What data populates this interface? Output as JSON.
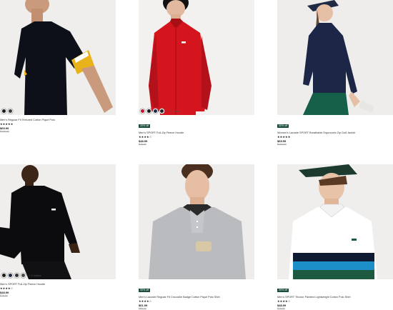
{
  "products": [
    {
      "badge": "",
      "name": "Men's Regular Fit Textured Cotton Piqué Polo",
      "stars": "★★★★★",
      "price": "$69.99",
      "old_price": "$100.00",
      "swatches": [
        "#1a1a1a",
        "#3b3b3b"
      ],
      "more": ""
    },
    {
      "badge": "30% off",
      "name": "Men's SPORT Full-Zip Fleece Hoodie",
      "stars": "★★★★☆",
      "price": "$48.99",
      "old_price": "$70.00",
      "swatches": [
        "#c8102e",
        "#1a1a1a",
        "#1f2a44",
        "#222222"
      ],
      "more": "+ 6 colors"
    },
    {
      "badge": "30% off",
      "name": "Women's Lacoste SPORT Breathable Ergonomic Zip Golf Jacket",
      "stars": "★★★★★",
      "price": "$69.99",
      "old_price": "$100.00",
      "swatches": [],
      "more": ""
    },
    {
      "badge": "",
      "name": "Men's SPORT Full-Zip Fleece Hoodie",
      "stars": "★★★★☆",
      "price": "$48.99",
      "old_price": "$70.00",
      "swatches": [
        "#1a1a1a",
        "#1f2a44",
        "#333333",
        "#4a4a4a"
      ],
      "more": "+ 2 colors"
    },
    {
      "badge": "30% off",
      "name": "Men's Lacoste Regular Fit Crocodile Badge Cotton Piqué Polo Shirt",
      "stars": "★★★★☆",
      "price": "$61.99",
      "old_price": "$89.00",
      "swatches": [],
      "more": ""
    },
    {
      "badge": "30% off",
      "name": "Men's SPORT Tricolor Paneled Lightweight Cotton Polo Shirt",
      "stars": "★★★★☆",
      "price": "$48.99",
      "old_price": "$70.00",
      "swatches": [],
      "more": ""
    }
  ]
}
